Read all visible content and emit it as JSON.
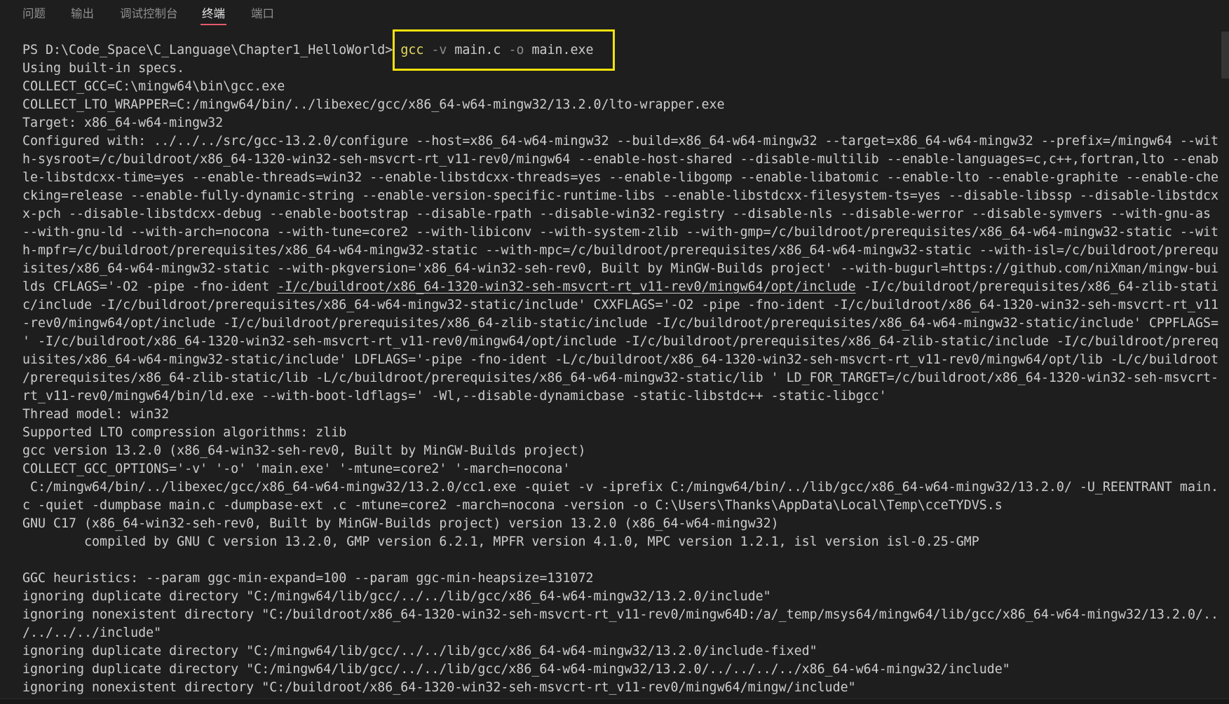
{
  "panel": {
    "tabs": [
      {
        "label": "问题",
        "active": false
      },
      {
        "label": "输出",
        "active": false
      },
      {
        "label": "调试控制台",
        "active": false
      },
      {
        "label": "终端",
        "active": true
      },
      {
        "label": "端口",
        "active": false
      }
    ]
  },
  "colors": {
    "background": "#1e1e1e",
    "foreground": "#cccccc",
    "tab_inactive": "#8f8f8f",
    "tab_active": "#e7e7e7",
    "tab_active_border": "#e55a6b",
    "command": "#e6dc5f",
    "parameter": "#8c8c8c",
    "highlight_box": "#f4e20b",
    "scrollbar": "#353535"
  },
  "terminal": {
    "prompt": "PS D:\\Code_Space\\C_Language\\Chapter1_HelloWorld> ",
    "command": {
      "program": "gcc",
      "tokens": [
        "-v",
        "main.c",
        "-o",
        "main.exe"
      ]
    },
    "lines": [
      "Using built-in specs.",
      "COLLECT_GCC=C:\\mingw64\\bin\\gcc.exe",
      "COLLECT_LTO_WRAPPER=C:/mingw64/bin/../libexec/gcc/x86_64-w64-mingw32/13.2.0/lto-wrapper.exe",
      "Target: x86_64-w64-mingw32",
      "Configured with: ../../../src/gcc-13.2.0/configure --host=x86_64-w64-mingw32 --build=x86_64-w64-mingw32 --target=x86_64-w64-mingw32 --prefix=/mingw64 --wit",
      "h-sysroot=/c/buildroot/x86_64-1320-win32-seh-msvcrt-rt_v11-rev0/mingw64 --enable-host-shared --disable-multilib --enable-languages=c,c++,fortran,lto --enab",
      "le-libstdcxx-time=yes --enable-threads=win32 --enable-libstdcxx-threads=yes --enable-libgomp --enable-libatomic --enable-lto --enable-graphite --enable-che",
      "cking=release --enable-fully-dynamic-string --enable-version-specific-runtime-libs --enable-libstdcxx-filesystem-ts=yes --disable-libssp --disable-libstdcx",
      "x-pch --disable-libstdcxx-debug --enable-bootstrap --disable-rpath --disable-win32-registry --disable-nls --disable-werror --disable-symvers --with-gnu-as",
      "--with-gnu-ld --with-arch=nocona --with-tune=core2 --with-libiconv --with-system-zlib --with-gmp=/c/buildroot/prerequisites/x86_64-w64-mingw32-static --wit",
      "h-mpfr=/c/buildroot/prerequisites/x86_64-w64-mingw32-static --with-mpc=/c/buildroot/prerequisites/x86_64-w64-mingw32-static --with-isl=/c/buildroot/prerequ",
      "isites/x86_64-w64-mingw32-static --with-pkgversion='x86_64-win32-seh-rev0, Built by MinGW-Builds project' --with-bugurl=https://github.com/niXman/mingw-bui",
      {
        "before": "lds CFLAGS='-O2 -pipe -fno-ident ",
        "link": "-I/c/buildroot/x86_64-1320-win32-seh-msvcrt-rt_v11-rev0/mingw64/opt/include",
        "after": " -I/c/buildroot/prerequisites/x86_64-zlib-stati"
      },
      "c/include -I/c/buildroot/prerequisites/x86_64-w64-mingw32-static/include' CXXFLAGS='-O2 -pipe -fno-ident -I/c/buildroot/x86_64-1320-win32-seh-msvcrt-rt_v11",
      "-rev0/mingw64/opt/include -I/c/buildroot/prerequisites/x86_64-zlib-static/include -I/c/buildroot/prerequisites/x86_64-w64-mingw32-static/include' CPPFLAGS=",
      "' -I/c/buildroot/x86_64-1320-win32-seh-msvcrt-rt_v11-rev0/mingw64/opt/include -I/c/buildroot/prerequisites/x86_64-zlib-static/include -I/c/buildroot/prereq",
      "uisites/x86_64-w64-mingw32-static/include' LDFLAGS='-pipe -fno-ident -L/c/buildroot/x86_64-1320-win32-seh-msvcrt-rt_v11-rev0/mingw64/opt/lib -L/c/buildroot",
      "/prerequisites/x86_64-zlib-static/lib -L/c/buildroot/prerequisites/x86_64-w64-mingw32-static/lib ' LD_FOR_TARGET=/c/buildroot/x86_64-1320-win32-seh-msvcrt-",
      "rt_v11-rev0/mingw64/bin/ld.exe --with-boot-ldflags=' -Wl,--disable-dynamicbase -static-libstdc++ -static-libgcc'",
      "Thread model: win32",
      "Supported LTO compression algorithms: zlib",
      "gcc version 13.2.0 (x86_64-win32-seh-rev0, Built by MinGW-Builds project)",
      "COLLECT_GCC_OPTIONS='-v' '-o' 'main.exe' '-mtune=core2' '-march=nocona'",
      " C:/mingw64/bin/../libexec/gcc/x86_64-w64-mingw32/13.2.0/cc1.exe -quiet -v -iprefix C:/mingw64/bin/../lib/gcc/x86_64-w64-mingw32/13.2.0/ -U_REENTRANT main.",
      "c -quiet -dumpbase main.c -dumpbase-ext .c -mtune=core2 -march=nocona -version -o C:\\Users\\Thanks\\AppData\\Local\\Temp\\cceTYDVS.s",
      "GNU C17 (x86_64-win32-seh-rev0, Built by MinGW-Builds project) version 13.2.0 (x86_64-w64-mingw32)",
      "        compiled by GNU C version 13.2.0, GMP version 6.2.1, MPFR version 4.1.0, MPC version 1.2.1, isl version isl-0.25-GMP",
      "",
      "GGC heuristics: --param ggc-min-expand=100 --param ggc-min-heapsize=131072",
      "ignoring duplicate directory \"C:/mingw64/lib/gcc/../../lib/gcc/x86_64-w64-mingw32/13.2.0/include\"",
      "ignoring nonexistent directory \"C:/buildroot/x86_64-1320-win32-seh-msvcrt-rt_v11-rev0/mingw64D:/a/_temp/msys64/mingw64/lib/gcc/x86_64-w64-mingw32/13.2.0/..",
      "/../../../include\"",
      "ignoring duplicate directory \"C:/mingw64/lib/gcc/../../lib/gcc/x86_64-w64-mingw32/13.2.0/include-fixed\"",
      "ignoring duplicate directory \"C:/mingw64/lib/gcc/../../lib/gcc/x86_64-w64-mingw32/13.2.0/../../../../x86_64-w64-mingw32/include\"",
      "ignoring nonexistent directory \"C:/buildroot/x86_64-1320-win32-seh-msvcrt-rt_v11-rev0/mingw64/mingw/include\""
    ]
  }
}
